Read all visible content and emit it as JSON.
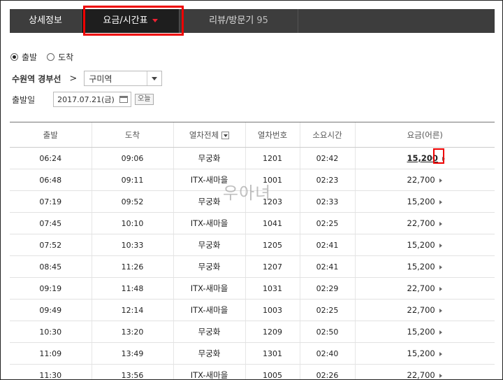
{
  "tabs": [
    {
      "label": "상세정보"
    },
    {
      "label": "요금/시간표"
    },
    {
      "label": "리뷰/방문기",
      "count": "95"
    }
  ],
  "direction": {
    "options": [
      "출발",
      "도착"
    ],
    "selected": "출발"
  },
  "route": {
    "from": "수원역 경부선",
    "arrow": ">",
    "destination": "구미역"
  },
  "date": {
    "label": "출발일",
    "value": "2017.07.21(금)",
    "today_button": "오늘"
  },
  "table": {
    "headers": [
      "출발",
      "도착",
      "열차전체",
      "열차번호",
      "소요시간",
      "요금(어른)"
    ],
    "rows": [
      [
        "06:24",
        "09:06",
        "무궁화",
        "1201",
        "02:42",
        "15,200"
      ],
      [
        "06:48",
        "09:11",
        "ITX-새마을",
        "1001",
        "02:23",
        "22,700"
      ],
      [
        "07:19",
        "09:52",
        "무궁화",
        "1203",
        "02:33",
        "15,200"
      ],
      [
        "07:45",
        "10:10",
        "ITX-새마을",
        "1041",
        "02:25",
        "22,700"
      ],
      [
        "07:52",
        "10:33",
        "무궁화",
        "1205",
        "02:41",
        "15,200"
      ],
      [
        "08:45",
        "11:26",
        "무궁화",
        "1207",
        "02:41",
        "15,200"
      ],
      [
        "09:19",
        "11:48",
        "ITX-새마을",
        "1031",
        "02:29",
        "22,700"
      ],
      [
        "09:49",
        "12:14",
        "ITX-새마을",
        "1003",
        "02:25",
        "22,700"
      ],
      [
        "10:30",
        "13:20",
        "무궁화",
        "1209",
        "02:50",
        "15,200"
      ],
      [
        "11:09",
        "13:49",
        "무궁화",
        "1301",
        "02:40",
        "15,200"
      ],
      [
        "11:30",
        "13:56",
        "ITX-새마을",
        "1005",
        "02:26",
        "22,700"
      ]
    ]
  },
  "watermark": "우아녀",
  "colors": {
    "highlight": "#e00000",
    "tabbar": "#3d3d3d",
    "caret": "#e22233"
  }
}
